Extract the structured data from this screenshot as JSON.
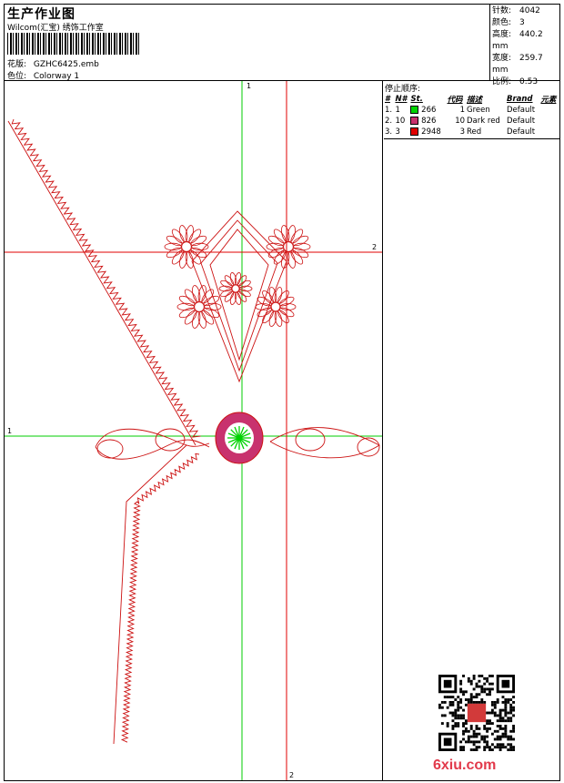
{
  "header": {
    "title": "生产作业图",
    "studio": "Wilcom(汇宝) 绣饰工作室",
    "design_label": "花版:",
    "design_value": "GZHC6425.emb",
    "colorway_label": "色位:",
    "colorway_value": "Colorway 1"
  },
  "stats": {
    "stitches_label": "针数:",
    "stitches_value": "4042",
    "colors_label": "颜色:",
    "colors_value": "3",
    "height_label": "高度:",
    "height_value": "440.2 mm",
    "width_label": "宽度:",
    "width_value": "259.7 mm",
    "scale_label": "比例:",
    "scale_value": "0.53"
  },
  "guides": {
    "green_top": "1",
    "green_left": "1",
    "red_right": "2",
    "red_bottom": "2",
    "green_color": "#00cc00",
    "red_color": "#e00000"
  },
  "stop_sequence": {
    "title": "停止顺序:",
    "headers": [
      "#",
      "N#",
      "St.",
      "代码",
      "描述",
      "Brand",
      "元素"
    ],
    "rows": [
      {
        "idx": "1.",
        "n": "1",
        "st": "266",
        "code": "1",
        "desc": "Green",
        "brand": "Default",
        "color": "#00d200"
      },
      {
        "idx": "2.",
        "n": "10",
        "st": "826",
        "code": "10",
        "desc": "Dark red",
        "brand": "Default",
        "color": "#c8326e"
      },
      {
        "idx": "3.",
        "n": "3",
        "st": "2948",
        "code": "3",
        "desc": "Red",
        "brand": "Default",
        "color": "#e00000"
      }
    ]
  },
  "branding": {
    "website": "6xiu.com",
    "qr_icon": "qr-code-icon",
    "seal_icon": "seal-stamp-icon"
  },
  "colors": {
    "thread_red": "#cc1111",
    "thread_darkred": "#c8326e",
    "thread_green": "#00d200"
  }
}
